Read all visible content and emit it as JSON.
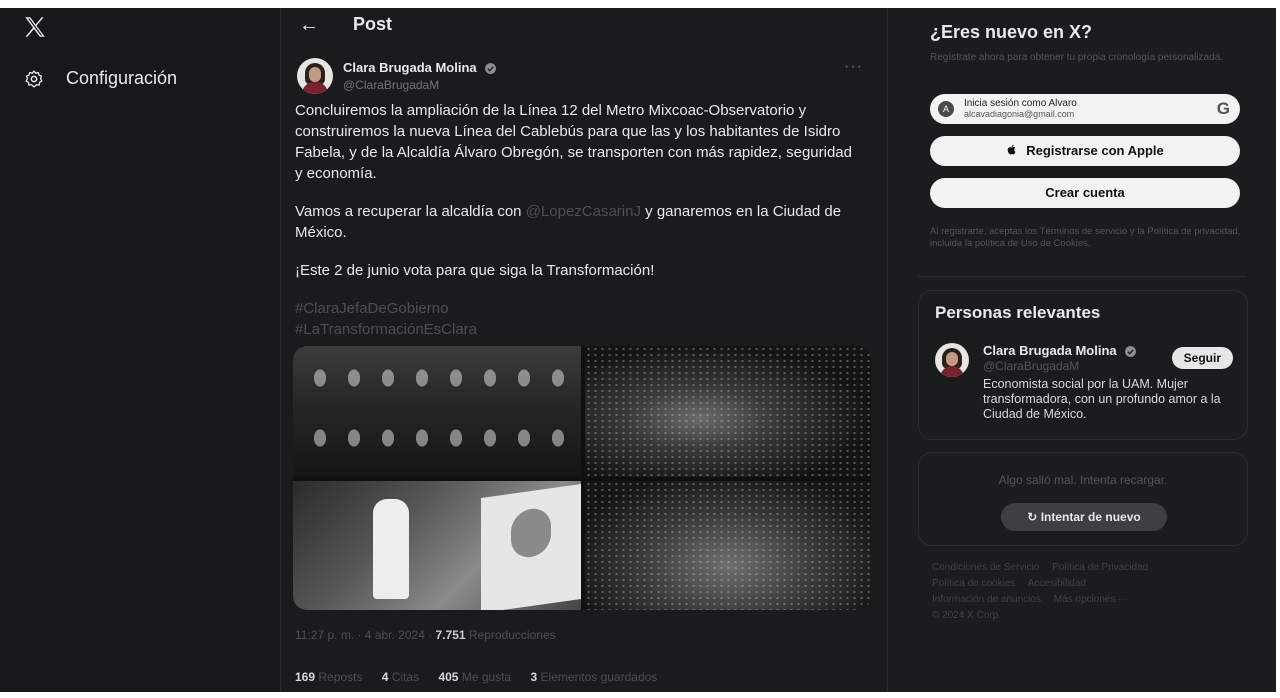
{
  "nav": {
    "settings_label": "Configuración"
  },
  "header": {
    "back_icon": "←",
    "title": "Post"
  },
  "post": {
    "author_name": "Clara Brugada Molina",
    "author_handle": "@ClaraBrugadaM",
    "more_icon": "···",
    "paragraph1": "Concluiremos la ampliación de la Línea 12 del Metro Mixcoac-Observatorio y construiremos la nueva Línea del Cablebús para que las y los habitantes de Isidro Fabela, y de la Alcaldía Álvaro Obregón, se transporten con más rapidez, seguridad y economía.",
    "paragraph2_before": "Vamos a recuperar la alcaldía con ",
    "paragraph2_mention": "@LopezCasarinJ",
    "paragraph2_after": " y ganaremos en la Ciudad de México.",
    "paragraph3": "¡Este 2 de junio vota para que siga la Transformación!",
    "hashtag1": "#ClaraJefaDeGobierno",
    "hashtag2": "#LaTransformaciónEsClara",
    "timestamp": "11:27 p. m. · 4 abr. 2024 · ",
    "views_count": "7.751",
    "views_label": " Reproducciones",
    "reposts_count": "169",
    "reposts_label": " Reposts",
    "quotes_count": "4",
    "quotes_label": " Citas",
    "likes_count": "405",
    "likes_label": " Me gusta",
    "bookmarks_count": "3",
    "bookmarks_label": " Elementos guardados"
  },
  "signup": {
    "title": "¿Eres nuevo en X?",
    "subtitle": "Regístrate ahora para obtener tu propia cronología personalizada.",
    "google_initial": "A",
    "google_line1": "Inicia sesión como Alvaro",
    "google_line2": "alcavadiagonia@gmail.com",
    "google_logo": "G",
    "apple_label": "Registrarse con Apple",
    "create_label": "Crear cuenta",
    "legal": "Al registrarte, aceptas los Términos de servicio y la Política de privacidad, incluida la política de Uso de Cookies."
  },
  "relevant": {
    "title": "Personas relevantes",
    "name": "Clara Brugada Molina",
    "handle": "@ClaraBrugadaM",
    "follow_label": "Seguir",
    "bio": "Economista social por la UAM. Mujer transformadora, con un profundo amor a la Ciudad de México."
  },
  "error": {
    "message": "Algo salió mal. Intenta recargar.",
    "retry_label": "Intentar de nuevo"
  },
  "footer": {
    "links": [
      "Condiciones de Servicio",
      "Política de Privacidad",
      "Política de cookies",
      "Accesibilidad",
      "Información de anuncios",
      "Más opciones ···"
    ],
    "copyright": "© 2024 X Corp."
  }
}
